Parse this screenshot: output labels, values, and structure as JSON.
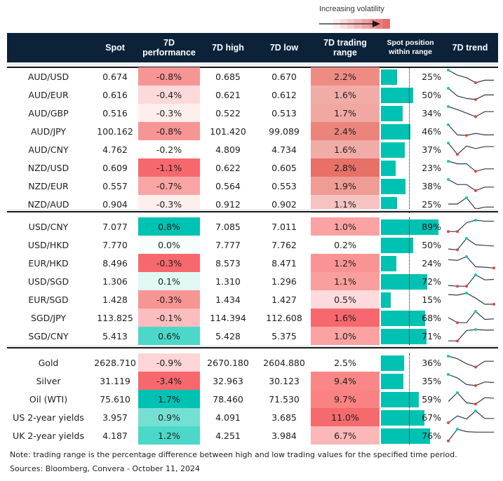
{
  "legend": {
    "label": "Increasing volatility",
    "gradient": [
      "#fdeeee",
      "#fbdcdc",
      "#f8caca",
      "#f5b7b7",
      "#f2a4a4",
      "#ef9191",
      "#ec7e7e",
      "#e96b6b"
    ]
  },
  "headers": {
    "spot": "Spot",
    "perf_line1": "7D",
    "perf_line2": "performance",
    "high": "7D high",
    "low": "7D low",
    "range_line1": "7D trading",
    "range_line2": "range",
    "pos_line1": "Spot position",
    "pos_line2": "within range",
    "trend": "7D trend"
  },
  "colors": {
    "header_bg": "#0b2239",
    "position_bar": "#00c2b2",
    "trend_line": "#2d3a4a",
    "trend_high_dot": "#18c9b6",
    "trend_low_dot": "#e8413c"
  },
  "groups": [
    {
      "rows": [
        {
          "name": "AUD/USD",
          "spot": "0.674",
          "perf": "-0.8%",
          "perf_bg": "#f79595",
          "high": "0.685",
          "low": "0.670",
          "range": "2.2%",
          "range_bg": "#ee8c84",
          "pos": 25,
          "pos_label": "25%",
          "trend": [
            5,
            3,
            2,
            0,
            1,
            1
          ],
          "hi": 0,
          "lo": 3
        },
        {
          "name": "AUD/EUR",
          "spot": "0.616",
          "perf": "-0.4%",
          "perf_bg": "#fcd9da",
          "high": "0.621",
          "low": "0.612",
          "range": "1.6%",
          "range_bg": "#f2aca8",
          "pos": 50,
          "pos_label": "50%",
          "trend": [
            5,
            2,
            1,
            0.6,
            2.4,
            2.4
          ],
          "hi": 0,
          "lo": 3
        },
        {
          "name": "AUD/GBP",
          "spot": "0.516",
          "perf": "-0.3%",
          "perf_bg": "#feeeee",
          "high": "0.522",
          "low": "0.513",
          "range": "1.7%",
          "range_bg": "#f1a8a3",
          "pos": 34,
          "pos_label": "34%",
          "trend": [
            5,
            3.8,
            2.4,
            1,
            3,
            3
          ],
          "hi": 0,
          "lo": 3
        },
        {
          "name": "AUD/JPY",
          "spot": "100.162",
          "perf": "-0.8%",
          "perf_bg": "#f79595",
          "high": "101.420",
          "low": "99.089",
          "range": "2.4%",
          "range_bg": "#eb857c",
          "pos": 46,
          "pos_label": "46%",
          "trend": [
            5,
            1,
            0.8,
            1.6,
            1,
            1
          ],
          "hi": 0,
          "lo": 2
        },
        {
          "name": "AUD/CNY",
          "spot": "4.762",
          "perf": "-0.2%",
          "perf_bg": "#ffffff",
          "high": "4.809",
          "low": "4.734",
          "range": "1.6%",
          "range_bg": "#f2aca8",
          "pos": 37,
          "pos_label": "37%",
          "trend": [
            5,
            0.5,
            3.8,
            2.8,
            3.6,
            3.6
          ],
          "hi": 0,
          "lo": 1
        },
        {
          "name": "NZD/USD",
          "spot": "0.609",
          "perf": "-1.1%",
          "perf_bg": "#f6686d",
          "high": "0.622",
          "low": "0.605",
          "range": "2.8%",
          "range_bg": "#e77067",
          "pos": 23,
          "pos_label": "23%",
          "trend": [
            5,
            4,
            4,
            1,
            2,
            2
          ],
          "hi": 0,
          "lo": 3
        },
        {
          "name": "NZD/EUR",
          "spot": "0.557",
          "perf": "-0.7%",
          "perf_bg": "#f9a5a6",
          "high": "0.564",
          "low": "0.553",
          "range": "1.9%",
          "range_bg": "#ef9c95",
          "pos": 38,
          "pos_label": "38%",
          "trend": [
            5,
            3,
            3,
            0.6,
            2,
            2
          ],
          "hi": 0,
          "lo": 3
        },
        {
          "name": "NZD/AUD",
          "spot": "0.904",
          "perf": "-0.3%",
          "perf_bg": "#feeeee",
          "high": "0.912",
          "low": "0.902",
          "range": "1.1%",
          "range_bg": "#f5c3c1",
          "pos": 25,
          "pos_label": "25%",
          "trend": [
            2.5,
            2.5,
            5,
            0.5,
            1.3,
            1.3
          ],
          "hi": 2,
          "lo": 3
        }
      ]
    },
    {
      "rows": [
        {
          "name": "USD/CNY",
          "spot": "7.077",
          "perf": "0.8%",
          "perf_bg": "#00c2b2",
          "high": "7.085",
          "low": "7.011",
          "range": "1.0%",
          "range_bg": "#fca2a2",
          "pos": 89,
          "pos_label": "89%",
          "trend": [
            0.5,
            0.5,
            4,
            5,
            4.6,
            4.6
          ],
          "hi": 3,
          "lo": 0,
          "lo2": 1
        },
        {
          "name": "USD/HKD",
          "spot": "7.770",
          "perf": "0.0%",
          "perf_bg": "#f6fdfc",
          "high": "7.777",
          "low": "7.762",
          "range": "0.2%",
          "range_bg": "#ffffff",
          "pos": 50,
          "pos_label": "50%",
          "trend": [
            0.8,
            0.5,
            5,
            2.5,
            2.2,
            2
          ],
          "hi": 2,
          "lo": 1
        },
        {
          "name": "EUR/HKD",
          "spot": "8.496",
          "perf": "-0.3%",
          "perf_bg": "#f6686d",
          "high": "8.573",
          "low": "8.471",
          "range": "1.2%",
          "range_bg": "#fa9494",
          "pos": 24,
          "pos_label": "24%",
          "trend": [
            3.8,
            3.5,
            5,
            1,
            0.8,
            0.5
          ],
          "hi": 2,
          "lo": 5
        },
        {
          "name": "USD/SGD",
          "spot": "1.306",
          "perf": "0.1%",
          "perf_bg": "#e0f7f4",
          "high": "1.310",
          "low": "1.296",
          "range": "1.1%",
          "range_bg": "#fb9e9e",
          "pos": 72,
          "pos_label": "72%",
          "trend": [
            0.8,
            0.5,
            0.5,
            5,
            3,
            3.2
          ],
          "hi": 3,
          "lo": 1,
          "lo2": 2
        },
        {
          "name": "EUR/SGD",
          "spot": "1.428",
          "perf": "-0.3%",
          "perf_bg": "#f79595",
          "high": "1.434",
          "low": "1.427",
          "range": "0.5%",
          "range_bg": "#fddadc",
          "pos": 15,
          "pos_label": "15%",
          "trend": [
            4.4,
            4.2,
            5,
            3,
            0.6,
            0.6
          ],
          "hi": 2,
          "lo": 5
        },
        {
          "name": "SGD/JPY",
          "spot": "113.825",
          "perf": "-0.1%",
          "perf_bg": "#fbbdbe",
          "high": "114.394",
          "low": "112.608",
          "range": "1.6%",
          "range_bg": "#f6686d",
          "pos": 68,
          "pos_label": "68%",
          "trend": [
            2.5,
            0.5,
            0.5,
            5,
            1.8,
            2
          ],
          "hi": 3,
          "lo": 1
        },
        {
          "name": "SGD/CNY",
          "spot": "5.413",
          "perf": "0.6%",
          "perf_bg": "#4cd8c8",
          "high": "5.428",
          "low": "5.375",
          "range": "1.0%",
          "range_bg": "#fca2a2",
          "pos": 71,
          "pos_label": "71%",
          "trend": [
            0.5,
            0.5,
            4.6,
            5,
            4.8,
            4.8
          ],
          "hi": 3,
          "lo": 1
        }
      ]
    },
    {
      "rows": [
        {
          "name": "Gold",
          "spot": "2628.710",
          "perf": "-0.9%",
          "perf_bg": "#fdd5d6",
          "high": "2670.180",
          "low": "2604.880",
          "range": "2.5%",
          "range_bg": "#ffffff",
          "pos": 36,
          "pos_label": "36%",
          "trend": [
            5,
            4,
            2,
            0.7,
            3,
            3
          ],
          "hi": 0,
          "lo": 3
        },
        {
          "name": "Silver",
          "spot": "31.119",
          "perf": "-3.4%",
          "perf_bg": "#f6686d",
          "high": "32.963",
          "low": "30.123",
          "range": "9.4%",
          "range_bg": "#fa8787",
          "pos": 35,
          "pos_label": "35%",
          "trend": [
            5,
            3.6,
            1,
            0.6,
            2,
            1.8
          ],
          "hi": 0,
          "lo": 3
        },
        {
          "name": "Oil (WTI)",
          "spot": "75.610",
          "perf": "1.7%",
          "perf_bg": "#00c2b2",
          "high": "78.460",
          "low": "71.530",
          "range": "9.7%",
          "range_bg": "#fa8282",
          "pos": 59,
          "pos_label": "59%",
          "trend": [
            1.5,
            5,
            1,
            0.5,
            3,
            2.8
          ],
          "hi": 1,
          "lo": 3
        },
        {
          "name": "US 2-year yields",
          "spot": "3.957",
          "perf": "0.9%",
          "perf_bg": "#74e0d4",
          "high": "4.091",
          "low": "3.685",
          "range": "11.0%",
          "range_bg": "#f56a6c",
          "pos": 67,
          "pos_label": "67%",
          "trend": [
            0.3,
            3,
            1.8,
            5,
            2,
            2
          ],
          "hi": 3,
          "lo": 0
        },
        {
          "name": "UK 2-year yields",
          "spot": "4.187",
          "perf": "1.2%",
          "perf_bg": "#4cd8c8",
          "high": "4.251",
          "low": "3.984",
          "range": "6.7%",
          "range_bg": "#fcb7b8",
          "pos": 76,
          "pos_label": "76%",
          "trend": [
            0.3,
            5,
            4,
            3.8,
            3.8,
            3.8
          ],
          "hi": 1,
          "lo": 0
        }
      ]
    }
  ],
  "notes": {
    "note": "Note: trading range is the percentage difference between high and low trading values for the specified time period.",
    "sources": "Sources: Bloomberg, Convera - October 11, 2024"
  }
}
